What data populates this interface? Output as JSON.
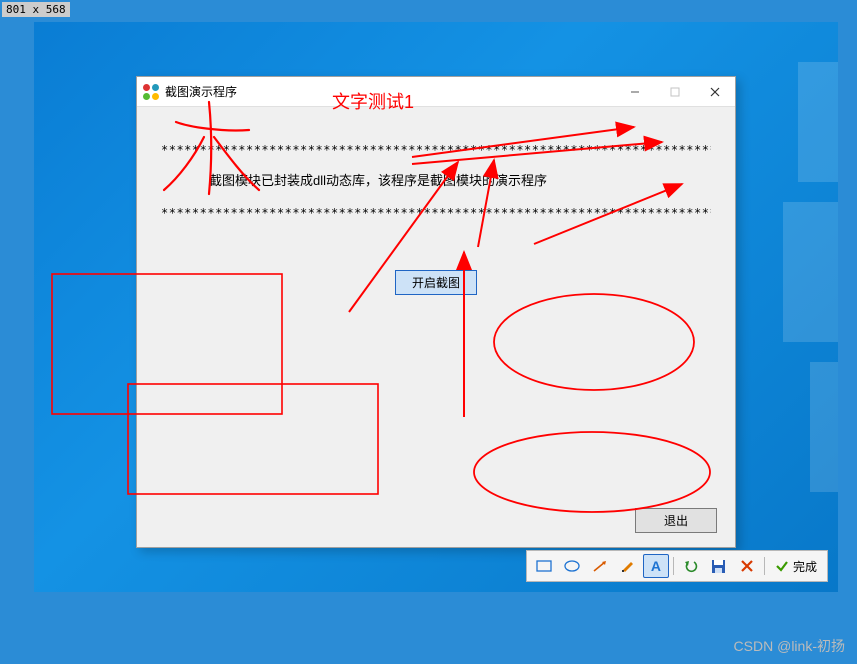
{
  "dimension_badge": "801 x 568",
  "dialog": {
    "title": "截图演示程序",
    "separator": "**************************************************************************",
    "description": "截图模块已封装成dll动态库，该程序是截图模块的演示程序",
    "start_button": "开启截图",
    "exit_button": "退出"
  },
  "annotation": {
    "text_test": "文字测试1"
  },
  "toolbar": {
    "complete": "完成"
  },
  "watermark": "CSDN @link-初扬"
}
